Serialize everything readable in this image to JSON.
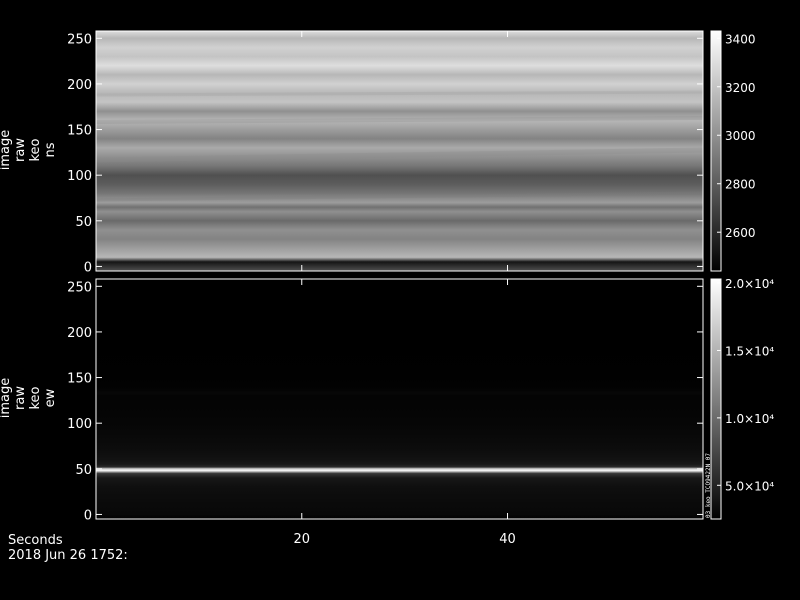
{
  "chart_data": [
    {
      "type": "heatmap",
      "ylabel": "image\nraw\nkeo\nns",
      "xlim": [
        0,
        59
      ],
      "ylim": [
        -5,
        258
      ],
      "yticks": [
        0,
        50,
        100,
        150,
        200,
        250
      ],
      "colorbar": {
        "range": [
          2440,
          3430
        ],
        "ticks": [
          2600,
          2800,
          3000,
          3200,
          3400
        ],
        "tick_labels": [
          "2600",
          "2800",
          "3000",
          "3200",
          "3400"
        ]
      },
      "row_profile": {
        "rows": [
          -5,
          5,
          10,
          20,
          30,
          40,
          50,
          60,
          65,
          70,
          80,
          90,
          100,
          110,
          120,
          130,
          140,
          150,
          160,
          170,
          180,
          190,
          200,
          210,
          220,
          230,
          240,
          250,
          258
        ],
        "values": [
          2750,
          2520,
          3150,
          3050,
          2950,
          3000,
          2850,
          3000,
          2880,
          3050,
          2900,
          2800,
          2750,
          2900,
          3000,
          3100,
          2950,
          3050,
          3150,
          3000,
          3200,
          3150,
          3250,
          3150,
          3300,
          3200,
          3250,
          3150,
          3300
        ]
      }
    },
    {
      "type": "heatmap",
      "ylabel": "image\nraw\nkeo\new",
      "xlim": [
        0,
        59
      ],
      "ylim": [
        -5,
        258
      ],
      "yticks": [
        0,
        50,
        100,
        150,
        200,
        250
      ],
      "xticks": [
        20,
        40
      ],
      "colorbar": {
        "range": [
          2500,
          20300
        ],
        "ticks": [
          5000,
          10000,
          15000,
          20000
        ],
        "tick_labels": [
          "5.0×10⁴",
          "1.0×10⁴",
          "1.5×10⁴",
          "2.0×10⁴"
        ],
        "annotation": "03_keo_TCO9422N_07"
      },
      "row_profile": {
        "rows": [
          -5,
          0,
          10,
          20,
          30,
          40,
          45,
          48,
          50,
          52,
          55,
          60,
          70,
          80,
          90,
          100,
          110,
          120,
          130,
          133,
          136,
          140,
          150,
          200,
          258
        ],
        "values": [
          3000,
          4200,
          4500,
          4800,
          5200,
          6200,
          9000,
          20000,
          18000,
          8000,
          6200,
          5500,
          5000,
          4600,
          4300,
          4000,
          3800,
          3700,
          3600,
          4200,
          3600,
          3200,
          2900,
          2700,
          2600
        ]
      }
    }
  ],
  "footer": {
    "xlabel": "Seconds",
    "date": "2018 Jun 26 1752:"
  }
}
